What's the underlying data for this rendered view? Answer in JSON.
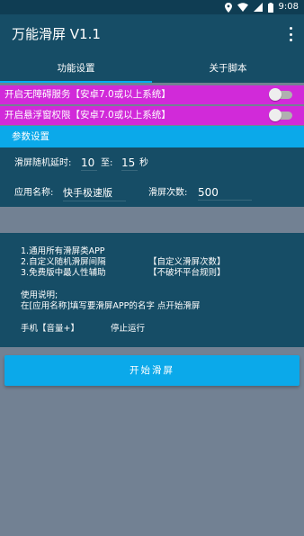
{
  "status_bar": {
    "time": "9:08"
  },
  "app_bar": {
    "title": "万能滑屏 V1.1"
  },
  "tabs": [
    {
      "label": "功能设置",
      "active": true
    },
    {
      "label": "关于脚本",
      "active": false
    }
  ],
  "toggles": [
    {
      "label": "开启无障碍服务【安卓7.0或以上系统】",
      "on": false
    },
    {
      "label": "开启悬浮窗权限【安卓7.0或以上系统】",
      "on": false
    }
  ],
  "params": {
    "header": "参数设置",
    "delay_label": "滑屏随机延时:",
    "delay_min": "10",
    "delay_to": "至:",
    "delay_max": "15",
    "delay_unit": "秒",
    "app_name_label": "应用名称:",
    "app_name_value": "快手极速版",
    "swipe_count_label": "滑屏次数:",
    "swipe_count_value": "500"
  },
  "info": {
    "feature1": "1.通用所有滑屏类APP",
    "feature2": "2.自定义随机滑屏间隔",
    "feature2_note": "【自定义滑屏次数】",
    "feature3": "3.免费版中最人性辅助",
    "feature3_note": "【不破坏平台规则】",
    "usage_title": "使用说明;",
    "usage_text": "在[应用名称]填写要滑屏APP的名字 点开始滑屏",
    "stop_hint_key": "手机【音量+】",
    "stop_hint_action": "停止运行"
  },
  "actions": {
    "start_label": "开始滑屏"
  },
  "colors": {
    "status_bar": "#0f3d53",
    "app_bar": "#164d66",
    "accent": "#0ba9ea",
    "toggle_row": "#d12ad9",
    "background": "#728193"
  }
}
